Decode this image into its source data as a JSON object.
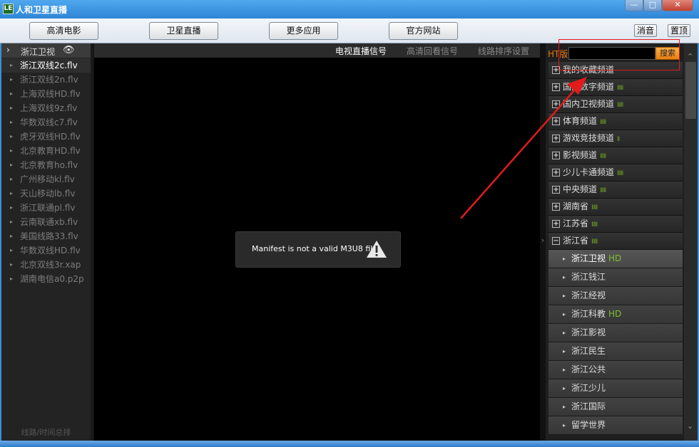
{
  "app": {
    "title": "人和卫星直播",
    "icon_letter": "LE"
  },
  "window": {
    "minimize": "—",
    "maximize": "□",
    "close": "✕"
  },
  "toolbar": {
    "buttons": [
      "高清电影",
      "卫星直播",
      "更多应用",
      "官方网站"
    ],
    "mute": "消音",
    "pin": "置顶"
  },
  "left": {
    "chevron": "›",
    "channel": "浙江卫视",
    "eye": "👁",
    "items": [
      "浙江双线2c.flv",
      "浙江双线2n.flv",
      "上海双线HD.flv",
      "上海双线9z.flv",
      "华数双线c7.flv",
      "虎牙双线HD.flv",
      "北京教育HD.flv",
      "北京教育ho.flv",
      "广州移动kl.flv",
      "天山移动lb.flv",
      "浙江联通pl.flv",
      "云南联通xb.flv",
      "美国线路33.flv",
      "华数双线HD.flv",
      "北京双线3r.xap",
      "湖南电信a0.p2p"
    ],
    "active_index": 0,
    "footer": "线路/时间总排"
  },
  "tabs": [
    "电视直播信号",
    "高清回看信号",
    "线路排序设置"
  ],
  "player": {
    "error_message": "Manifest is not a valid M3U8 file"
  },
  "right": {
    "ht_label": "HT版",
    "search_value": "",
    "search_button": "搜索",
    "categories": [
      {
        "label": "我的收藏频道",
        "bars": ""
      },
      {
        "label": "国内数字频道",
        "bars": "IIIII"
      },
      {
        "label": "国内卫视频道",
        "bars": "IIIII"
      },
      {
        "label": "体育频道",
        "bars": "IIIII"
      },
      {
        "label": "游戏竞技频道",
        "bars": "II"
      },
      {
        "label": "影视频道",
        "bars": "IIIII"
      },
      {
        "label": "少儿卡通频道",
        "bars": "IIIII"
      },
      {
        "label": "中央频道",
        "bars": "IIIII"
      },
      {
        "label": "湖南省",
        "bars": "IIIII"
      },
      {
        "label": "江苏省",
        "bars": "IIIII"
      },
      {
        "label": "浙江省",
        "bars": "IIIII"
      }
    ],
    "expanded_sign": "−",
    "collapsed_sign": "+",
    "subchannels": [
      {
        "label": "浙江卫视",
        "hd": "HD"
      },
      {
        "label": "浙江钱江",
        "hd": ""
      },
      {
        "label": "浙江经视",
        "hd": ""
      },
      {
        "label": "浙江科教",
        "hd": "HD"
      },
      {
        "label": "浙江影视",
        "hd": ""
      },
      {
        "label": "浙江民生",
        "hd": ""
      },
      {
        "label": "浙江公共",
        "hd": ""
      },
      {
        "label": "浙江少儿",
        "hd": ""
      },
      {
        "label": "浙江国际",
        "hd": ""
      },
      {
        "label": "留学世界",
        "hd": ""
      }
    ],
    "active_sub_index": 0
  },
  "colors": {
    "accent_orange": "#e8750c",
    "hd_green": "#7cc12d",
    "annotation_red": "#e31b1b",
    "title_blue": "#2f86d6"
  }
}
